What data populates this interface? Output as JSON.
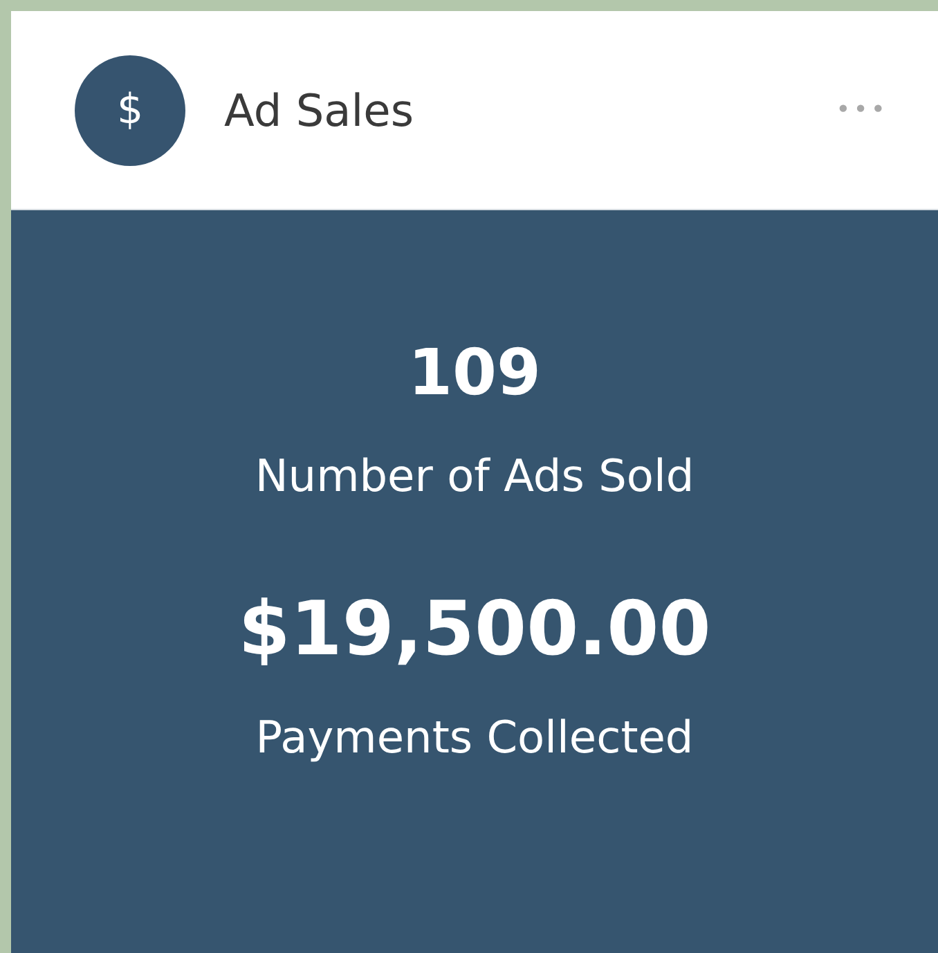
{
  "card": {
    "title": "Ad Sales",
    "icon_text": "$",
    "menu": "•••"
  },
  "stats": [
    {
      "value": "109",
      "label": "Number of Ads Sold"
    },
    {
      "value": "$19,500.00",
      "label": "Payments Collected"
    }
  ]
}
